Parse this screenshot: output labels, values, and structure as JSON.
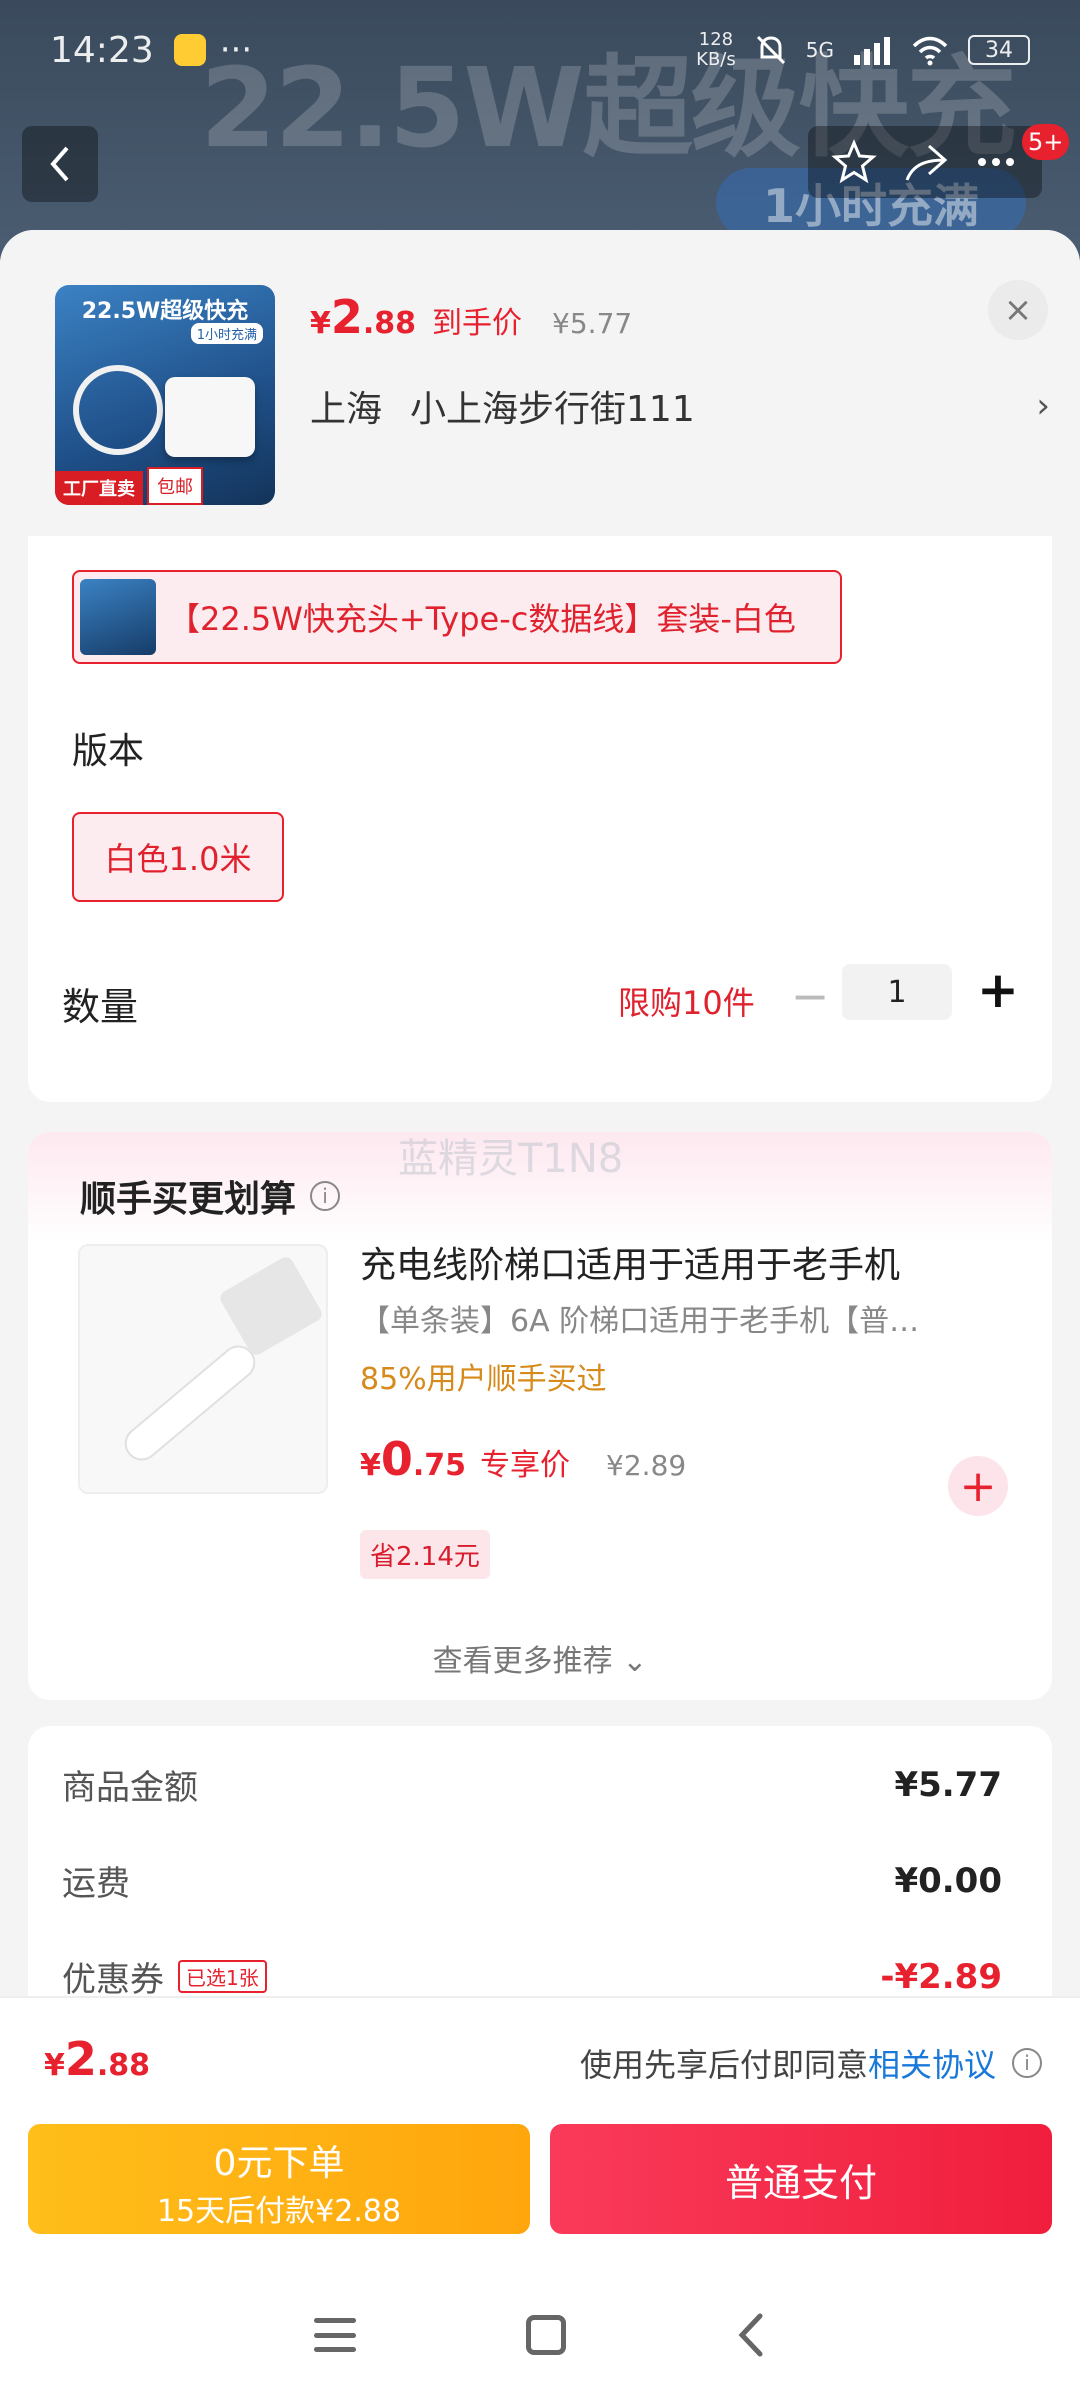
{
  "status_bar": {
    "time": "14:23",
    "dots": "···",
    "net_speed_value": "128",
    "net_speed_unit": "KB/s",
    "network": "5G",
    "battery": "34"
  },
  "background": {
    "banner_text": "22.5W超级快充",
    "pill_text": "1小时充满",
    "badge": "5+"
  },
  "product": {
    "thumb_title": "22.5W超级快充",
    "thumb_sub": "1小时充满",
    "thumb_tag_factory": "工厂直卖",
    "thumb_tag_shipping": "包邮",
    "price_yen": "¥",
    "price_int": "2",
    "price_dec": ".88",
    "price_label": "到手价",
    "price_original": "¥5.77",
    "address_city": "上海",
    "address_detail": "小上海步行街111"
  },
  "spec": {
    "sku_text": "【22.5W快充头+Type-c数据线】套装-白色",
    "version_title": "版本",
    "version_option": "白色1.0米",
    "qty_title": "数量",
    "qty_limit": "限购10件",
    "qty_value": "1",
    "qty_minus": "−",
    "qty_plus": "+"
  },
  "recommend": {
    "title": "顺手买更划算",
    "watermark": "蓝精灵T1N8",
    "item_name": "充电线阶梯口适用于适用于老手机",
    "item_desc": "【单条装】6A 阶梯口适用于老手机【普…",
    "item_buyers": "85%用户顺手买过",
    "item_price_yen": "¥",
    "item_price_int": "0",
    "item_price_dec": ".75",
    "item_price_label": "专享价",
    "item_price_original": "¥2.89",
    "item_save": "省2.14元",
    "more": "查看更多推荐 ⌄"
  },
  "summary": {
    "goods_label": "商品金额",
    "goods_value": "¥5.77",
    "shipping_label": "运费",
    "shipping_value": "¥0.00",
    "coupon_label": "优惠券",
    "coupon_tag": "已选1张",
    "coupon_value": "-¥2.89"
  },
  "footer": {
    "total_yen": "¥",
    "total_int": "2",
    "total_dec": ".88",
    "agree_text": "使用先享后付即同意",
    "agree_link": "相关协议",
    "zero_order_main": "0元下单",
    "zero_order_sub": "15天后付款¥2.88",
    "normal_pay": "普通支付"
  },
  "colors": {
    "accent_red": "#e8212e",
    "link_blue": "#1a78d8",
    "pay_yellow": "#ffbe1a"
  }
}
